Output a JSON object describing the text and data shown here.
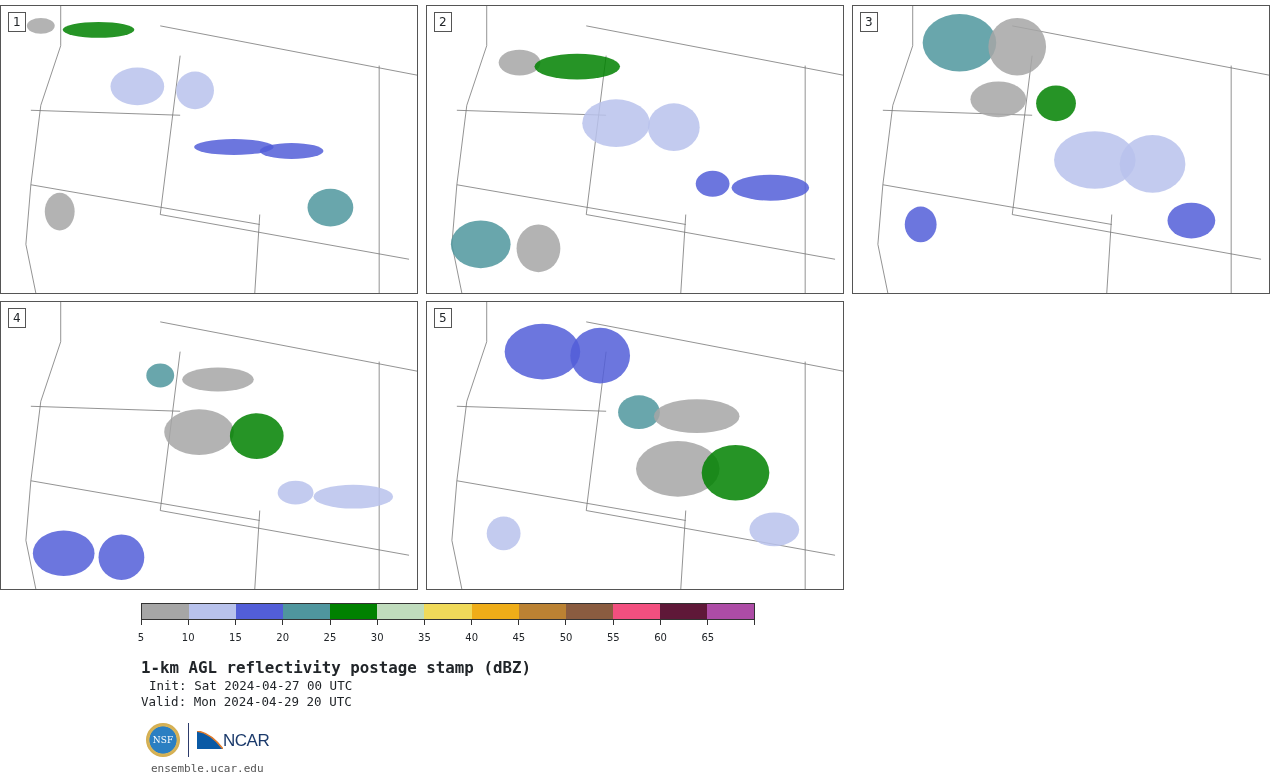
{
  "panels": [
    {
      "label": "1"
    },
    {
      "label": "2"
    },
    {
      "label": "3"
    },
    {
      "label": "4"
    },
    {
      "label": "5"
    }
  ],
  "colorbar": {
    "segments": [
      {
        "color": "#a6a6a6"
      },
      {
        "color": "#b8c2ec"
      },
      {
        "color": "#525ed8"
      },
      {
        "color": "#4f969e"
      },
      {
        "color": "#008100"
      },
      {
        "color": "#c0dcbd"
      },
      {
        "color": "#f0da5a"
      },
      {
        "color": "#efad18"
      },
      {
        "color": "#bb8233"
      },
      {
        "color": "#8a5c40"
      },
      {
        "color": "#f24f7f"
      },
      {
        "color": "#5f1838"
      },
      {
        "color": "#ad4ca6"
      }
    ],
    "ticks": [
      "5",
      "10",
      "15",
      "20",
      "25",
      "30",
      "35",
      "40",
      "45",
      "50",
      "55",
      "60",
      "65"
    ]
  },
  "title": "1-km AGL reflectivity postage stamp (dBZ)",
  "init": "Init: Sat 2024-04-27 00 UTC",
  "valid": "Valid: Mon 2024-04-29 20 UTC",
  "logos": {
    "seal": "NSF",
    "wordmark": "NCAR"
  },
  "url": "ensemble.ucar.edu"
}
